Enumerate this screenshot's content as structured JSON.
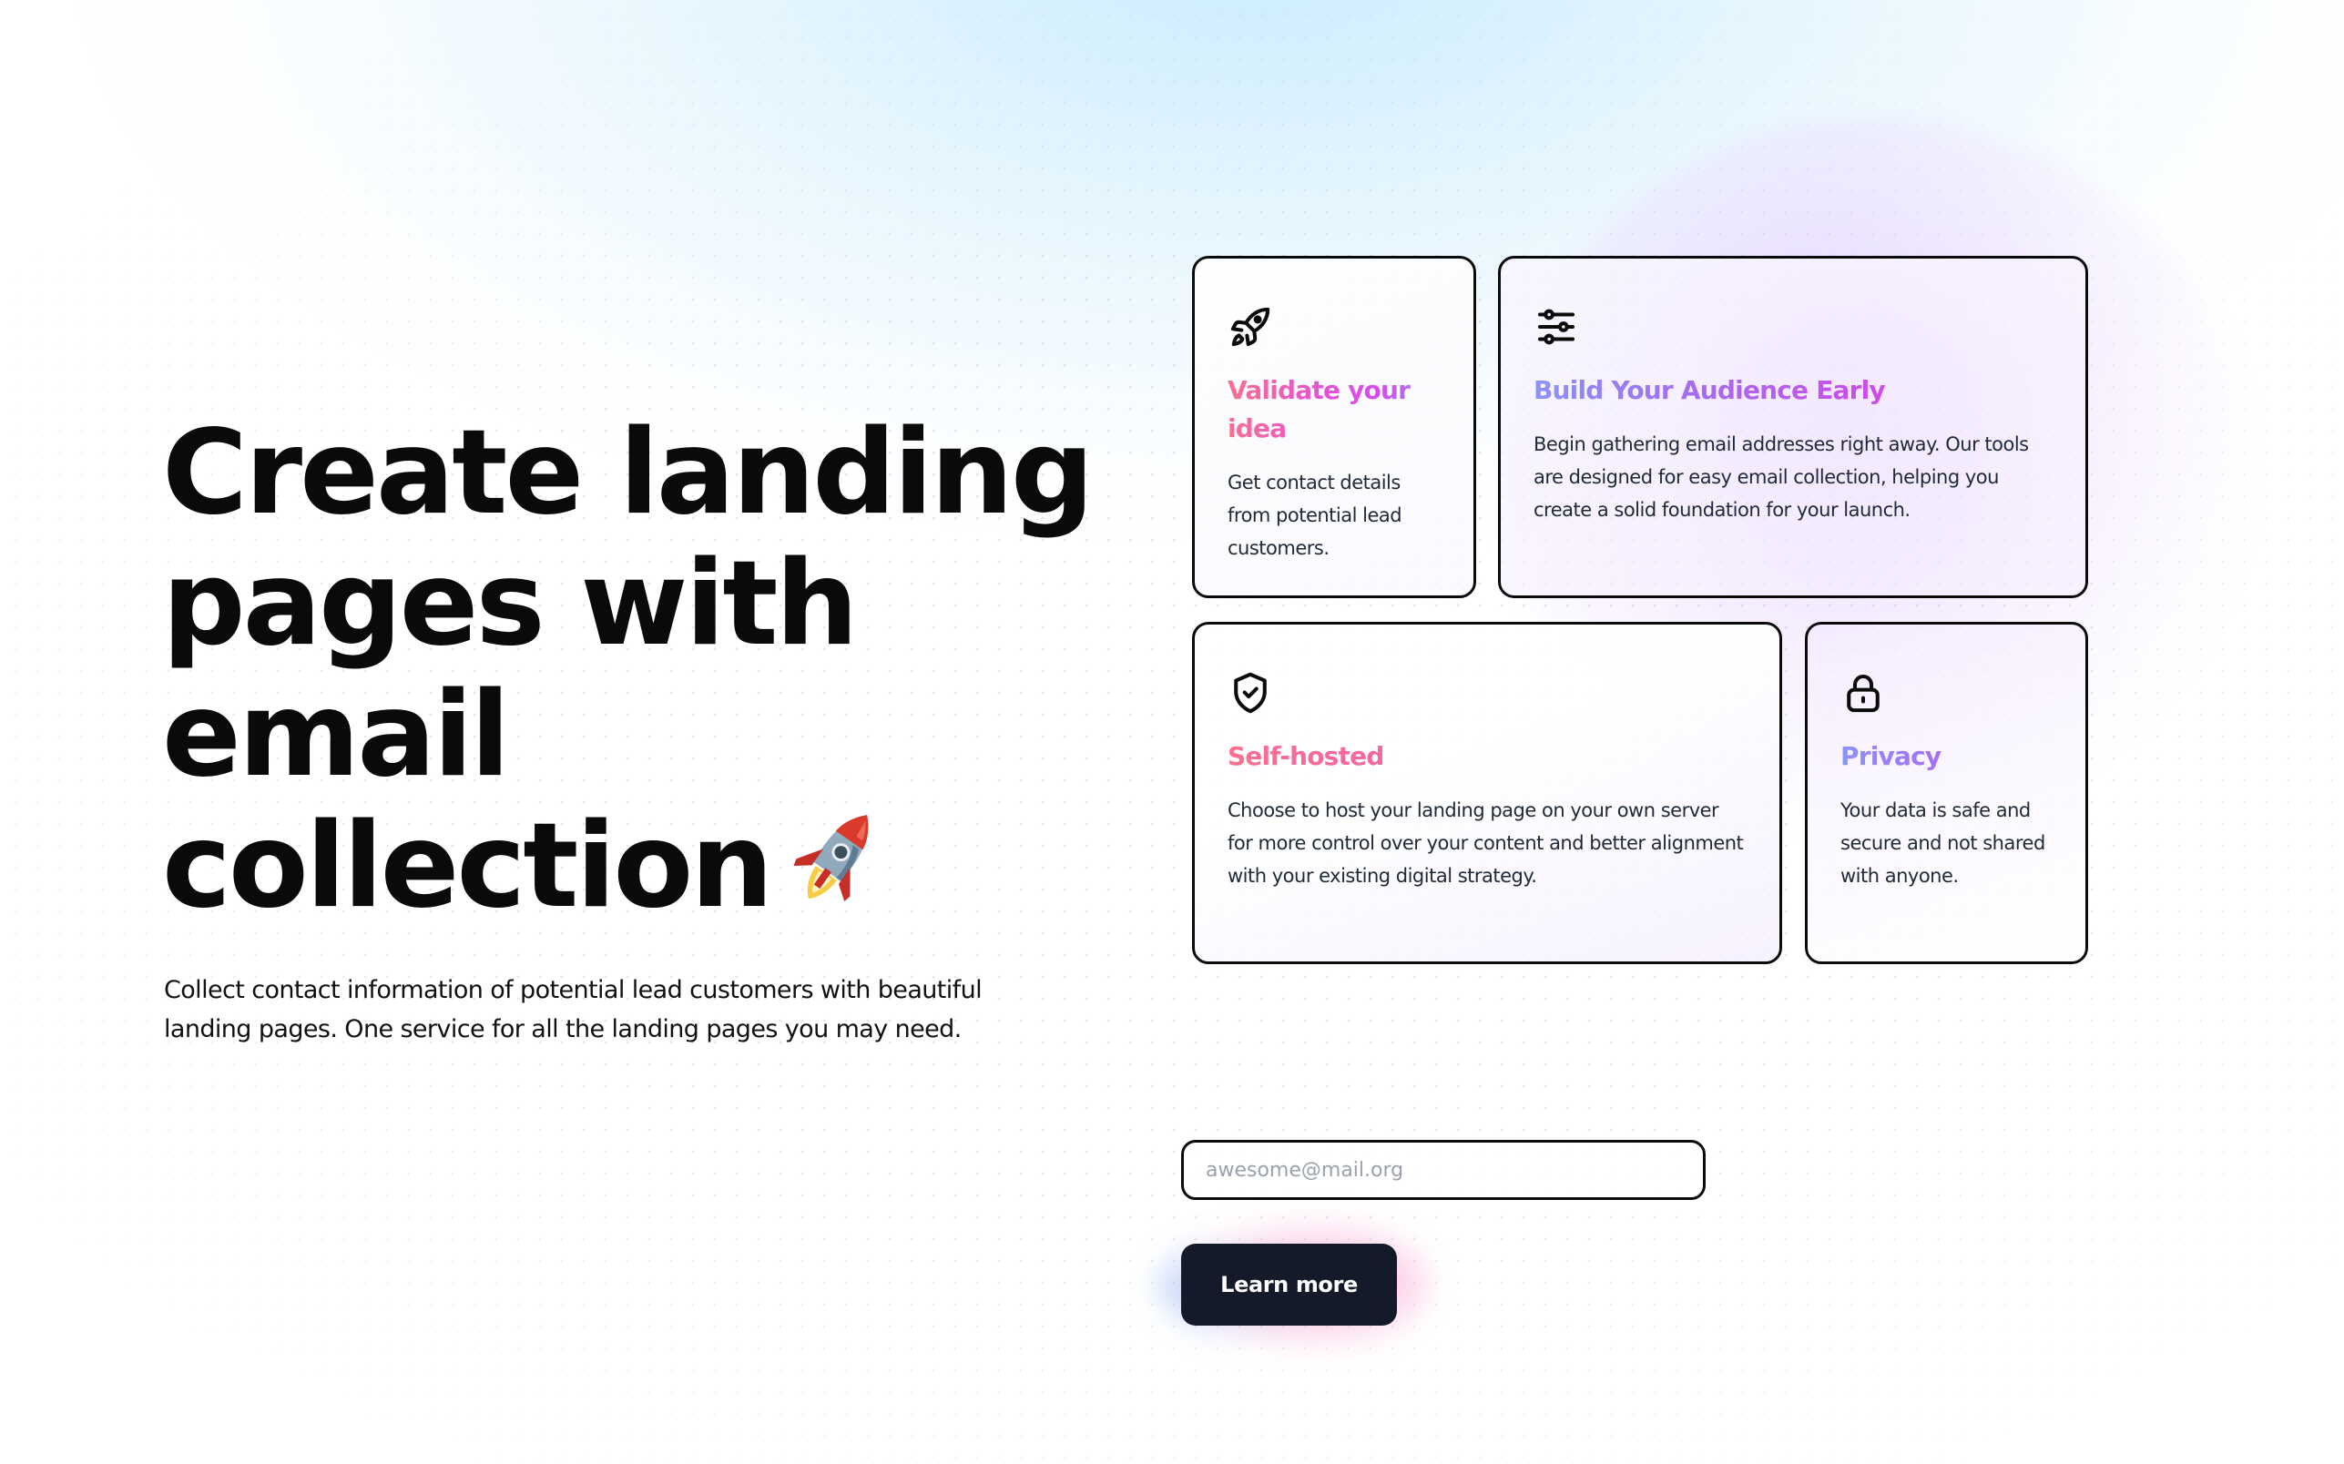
{
  "hero": {
    "title_line1": "Create landing",
    "title_line2": "pages with",
    "title_line3": "email",
    "title_line4": "collection",
    "title_emoji": "🚀",
    "subtitle": "Collect contact information of potential lead customers with beautiful landing pages. One service for all the landing pages you may need."
  },
  "features": [
    {
      "icon": "rocket-icon",
      "title": "Validate your idea",
      "description": "Get contact details from potential lead customers."
    },
    {
      "icon": "sliders-icon",
      "title": "Build Your Audience Early",
      "description": "Begin gathering email addresses right away. Our tools are designed for easy email collection, helping you create a solid foundation for your launch."
    },
    {
      "icon": "shield-check-icon",
      "title": "Self-hosted",
      "description": "Choose to host your landing page on your own server for more control over your content and better alignment with your existing digital strategy."
    },
    {
      "icon": "lock-icon",
      "title": "Privacy",
      "description": "Your data is safe and secure and not shared with anyone."
    }
  ],
  "signup": {
    "email_placeholder": "awesome@mail.org",
    "email_value": "",
    "button_label": "Learn more"
  },
  "colors": {
    "button_bg": "#141a29",
    "card_border": "#0b0b0b",
    "title_gradient_pink": "#fb6f8f",
    "title_gradient_fuchsia": "#d946ef",
    "title_gradient_violet": "#8b93f8",
    "body_text": "#1f2937",
    "placeholder": "#9aa1ad"
  }
}
